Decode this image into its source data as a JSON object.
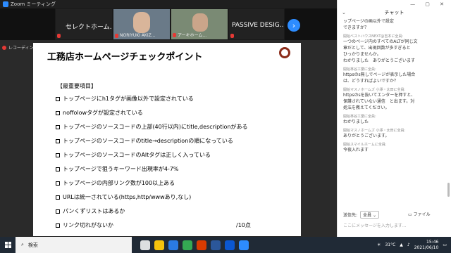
{
  "window": {
    "title": "Zoom ミーティング"
  },
  "video": {
    "tiles": [
      {
        "name": "セレクトホーム...",
        "footer": ""
      },
      {
        "name": "",
        "footer": "NORIYUKI AKIZ..."
      },
      {
        "name": "",
        "footer": "アーキホーム..."
      },
      {
        "name": "PASSIVE DESIG...",
        "footer": ""
      }
    ],
    "next_icon": "chevron-right-icon"
  },
  "recording": {
    "label": "レコーディング"
  },
  "slide": {
    "title": "工務店ホームページチェックポイント",
    "section": "【最重要項目】",
    "items": [
      "トップページにh1タグが画像以外で設定されている",
      "noffolowタグが設定されている",
      "トップページのソースコードの上部(40行以内)にtitle,descriptionがある",
      "トップページのソースコードのtitle→descriptionの順になっている",
      "トップページのソースコードのAltタグは正しく入っている",
      "トップページで狙うキーワード出現率が4-7%",
      "トップページの内部リンク数が100以上ある",
      "URLは統一されている(https,http/wwwあり,なし)",
      "パンくずリストはあるか",
      "リンク切れがないか"
    ],
    "score": "/10点"
  },
  "chat": {
    "title": "チャット",
    "messages": [
      {
        "from": "",
        "lines": [
          "ップページの画以外で設定",
          "できますか？"
        ]
      },
      {
        "from": "開始ベストハウスNEXT@吉本に全員:",
        "lines": [
          "一つのページ内のすべてのALTが同じ文",
          "章だとして、出現回数が多すぎると",
          "ひっかりませんか。",
          "わかりました　ありがとうございます"
        ]
      },
      {
        "from": "開始林谷工業に全員:",
        "lines": [
          "httpsのs無しでページが表示した場合",
          "は、どうすればよいですか？"
        ]
      },
      {
        "from": "開始マスノホームズ 小澤・太田に全員:",
        "lines": [
          "httpsのsを抜いてエンターを押すと、",
          "保護されていない通信　と出ます。対",
          "処法を教えてください。"
        ]
      },
      {
        "from": "開始林谷工業に全員:",
        "lines": [
          "わかりました"
        ]
      },
      {
        "from": "開始マスノホームズ 小澤・太田に全員:",
        "lines": [
          "ありがとうございます。"
        ]
      },
      {
        "from": "開始スマイルホームに全員:",
        "lines": [
          "今夜入れます"
        ]
      }
    ],
    "send_to_label": "送信先:",
    "send_to_value": "全員",
    "file_label": "ファイル",
    "input_placeholder": "ここにメッセージを入力します..."
  },
  "taskbar": {
    "search_label": "検索",
    "temperature": "31°C",
    "time": "15:46",
    "date": "2021/06/10"
  }
}
